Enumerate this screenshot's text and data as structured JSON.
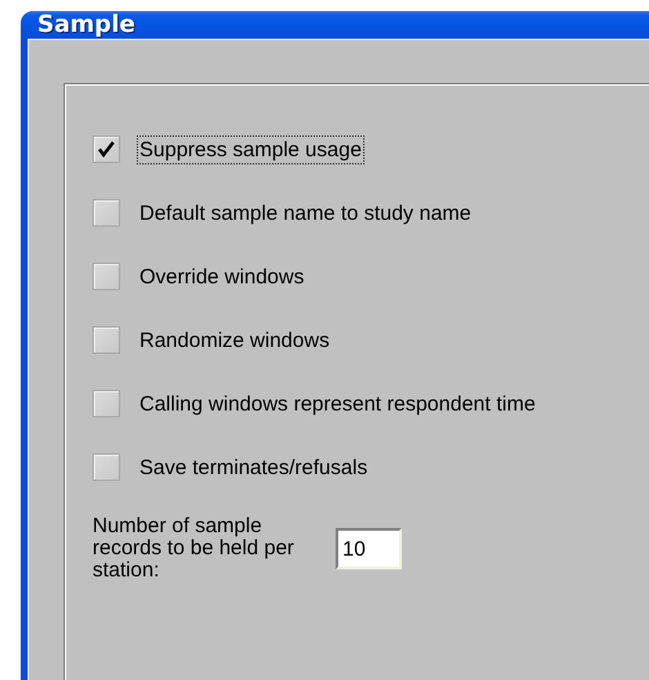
{
  "window": {
    "title": "Sample"
  },
  "options": [
    {
      "label": "Suppress sample usage",
      "checked": true,
      "focused": true
    },
    {
      "label": "Default sample name to study name",
      "checked": false,
      "focused": false
    },
    {
      "label": "Override windows",
      "checked": false,
      "focused": false
    },
    {
      "label": "Randomize windows",
      "checked": false,
      "focused": false
    },
    {
      "label": "Calling windows represent respondent time",
      "checked": false,
      "focused": false
    },
    {
      "label": "Save terminates/refusals",
      "checked": false,
      "focused": false
    }
  ],
  "records_field": {
    "label": "Number of sample records to be held per station:",
    "value": "10"
  }
}
